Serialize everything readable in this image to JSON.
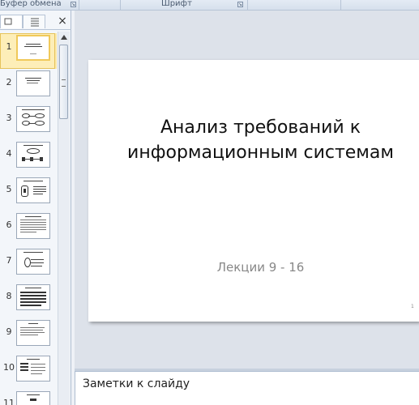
{
  "ribbon": {
    "groups": [
      {
        "label": "Буфер обмена"
      },
      {
        "label": "Шрифт"
      }
    ]
  },
  "slides_pane": {
    "close_label": "×",
    "selected": 1,
    "items": [
      {
        "number": "1"
      },
      {
        "number": "2"
      },
      {
        "number": "3"
      },
      {
        "number": "4"
      },
      {
        "number": "5"
      },
      {
        "number": "6"
      },
      {
        "number": "7"
      },
      {
        "number": "8"
      },
      {
        "number": "9"
      },
      {
        "number": "10"
      },
      {
        "number": "11"
      }
    ]
  },
  "slide": {
    "title": "Анализ требований к информационным системам",
    "subtitle": "Лекции 9 - 16",
    "page_number": "1"
  },
  "notes": {
    "placeholder": "Заметки к слайду"
  },
  "colors": {
    "selection": "#fbe7a6",
    "editor_background": "#dde2ea"
  }
}
